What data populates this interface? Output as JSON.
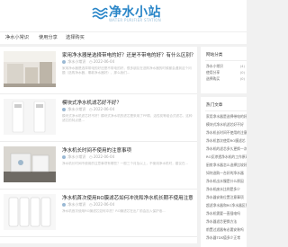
{
  "header": {
    "logo_text": "净水小站",
    "logo_sub": "WATER PURIFIER STATION"
  },
  "nav": {
    "items": [
      "净水小常识",
      "使用分享",
      "选择购买"
    ]
  },
  "articles": [
    {
      "title": "家用净水器是选择带电的好？还是不带电的好？有什么区别？",
      "author": "净水小常识",
      "date": "2022-06-04",
      "excerpt": "家用净水器是选择带电的好还是不带电的好，很多朋友在选购净水器的时候都会遇到这个问题（选购净水器，哪款净水器好），那么我们..."
    },
    {
      "title": "模块式净水机滤芯好不好？",
      "author": "净水小常识",
      "date": "2022-06-04",
      "excerpt": "模块式净水机滤芯好不好？模块式净水机的滤芯是采用了PP棉、活性炭等组合式滤芯，这种滤芯的特点是..."
    },
    {
      "title": "净水机长时间不使用的注意事项",
      "author": "净水小常识",
      "date": "2022-06-04",
      "excerpt": "净水机长时间不使用的注意事项有哪些？一般三个月及以上，不使用净水机时，建议在..."
    },
    {
      "title": "净水机首次使用RO膜滤芯如何冲洗和净水机长期不使用注意事项。",
      "author": "净水小常识",
      "date": "2022-06-04",
      "excerpt": "净水机首次使用RO膜滤芯如何冲洗？RO膜滤芯在出厂前会加入保护液..."
    }
  ],
  "sidebar": {
    "category_title": "网站分类",
    "categories": [
      {
        "label": "净水小常识",
        "count": "(4)"
      },
      {
        "label": "使用分享",
        "count": "(0)"
      },
      {
        "label": "选择购买",
        "count": "(0)"
      }
    ],
    "recent_title": "热门文章",
    "recent": [
      "家用净水器是选择带电的好",
      "模块式净水机滤芯好不好",
      "净水机长时间不使用的注意",
      "净水机首次使用RO膜滤芯",
      "净水机的滤芯多久更换一次",
      "RO反渗透净水机的工作原理",
      "厨房净水器怎么选择比较好",
      "如何选购一台好的净水器",
      "净水机出水慢是什么原因",
      "净水机废水比例是多少",
      "净水器安装位置注意事项",
      "超滤净水器和RO净水器区别",
      "净水机需要一直插电吗",
      "净水器滤芯更换方法",
      "前置过滤器有必要安装吗",
      "净水器TDS值多少正常"
    ]
  },
  "colors": {
    "brand": "#2a86c8",
    "background": "#f1f1f1"
  }
}
